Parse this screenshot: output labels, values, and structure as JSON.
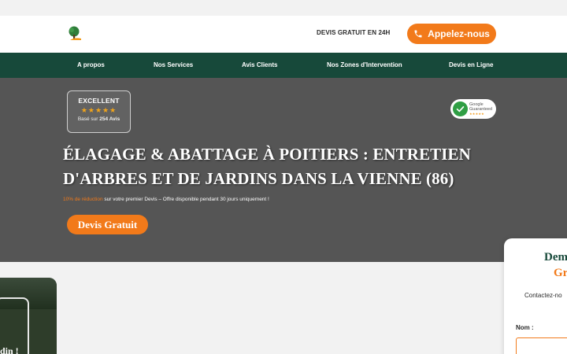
{
  "header": {
    "tagline": "DEVIS GRATUIT EN 24H",
    "call_button_label": "Appelez-nous",
    "logo_icon": "tree-icon",
    "phone_icon": "phone-icon"
  },
  "nav": {
    "items": [
      {
        "label": "A propos"
      },
      {
        "label": "Nos Services"
      },
      {
        "label": "Avis Clients"
      },
      {
        "label": "Nos Zones d'Intervention"
      },
      {
        "label": "Devis en Ligne"
      }
    ]
  },
  "hero": {
    "badge": {
      "title": "EXCELLENT",
      "stars": "★★★★★",
      "rating_stars": 5,
      "based_on_prefix": "Basé sur",
      "based_on_count": "254 Avis"
    },
    "google_badge": {
      "line1": "Google",
      "line2": "Guaranteed",
      "stars": "★★★★★"
    },
    "title": "ÉLAGAGE & ABATTAGE À POITIERS : ENTRETIEN D'ARBRES ET DE JARDINS DANS LA VIENNE (86)",
    "promo_highlight": "10% de réduction",
    "promo_rest": " sur votre premier Devis – Offre disponible pendant 30 jours uniquement !",
    "cta_label": "Devis Gratuit"
  },
  "lower": {
    "photo_caption": "din !"
  },
  "form": {
    "title_line1": "Dem",
    "title_line2": "Gr",
    "subtitle": "Contactez-no",
    "name_label": "Nom :",
    "name_value": ""
  },
  "colors": {
    "brand_green": "#17493a",
    "accent_orange": "#f27a1a",
    "hero_bg": "#555555"
  }
}
